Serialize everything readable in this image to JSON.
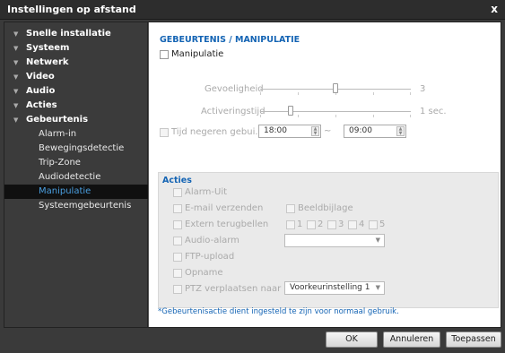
{
  "window": {
    "title": "Instellingen op afstand",
    "close": "x"
  },
  "sidebar": {
    "items": [
      {
        "label": "Snelle installatie",
        "level": "top"
      },
      {
        "label": "Systeem",
        "level": "top"
      },
      {
        "label": "Netwerk",
        "level": "top"
      },
      {
        "label": "Video",
        "level": "top"
      },
      {
        "label": "Audio",
        "level": "top"
      },
      {
        "label": "Acties",
        "level": "top"
      },
      {
        "label": "Gebeurtenis",
        "level": "top"
      },
      {
        "label": "Alarm-in",
        "level": "sub"
      },
      {
        "label": "Bewegingsdetectie",
        "level": "sub"
      },
      {
        "label": "Trip-Zone",
        "level": "sub"
      },
      {
        "label": "Audiodetectie",
        "level": "sub"
      },
      {
        "label": "Manipulatie",
        "level": "sub",
        "selected": true
      },
      {
        "label": "Systeemgebeurtenis",
        "level": "sub"
      }
    ]
  },
  "main": {
    "title": "GEBEURTENIS / MANIPULATIE",
    "manipulatie_label": "Manipulatie",
    "sensitivity": {
      "label": "Gevoeligheid",
      "value": "3",
      "level": 3,
      "max": 5
    },
    "activation": {
      "label": "Activeringstijd",
      "value": "1 sec.",
      "level": 1,
      "max": 5
    },
    "ignore": {
      "label": "Tijd negeren gebui...",
      "from": "18:00",
      "sep": "~",
      "to": "09:00"
    },
    "actions": {
      "title": "Acties",
      "alarm_out": "Alarm-Uit",
      "email": "E-mail verzenden",
      "attachment": "Beeldbijlage",
      "callback": "Extern terugbellen",
      "callback_opts": [
        "1",
        "2",
        "3",
        "4",
        "5"
      ],
      "audio": "Audio-alarm",
      "audio_select": "",
      "ftp": "FTP-upload",
      "record": "Opname",
      "ptz": "PTZ verplaatsen naar",
      "ptz_select": "Voorkeurinstelling  1"
    },
    "note": "*Gebeurtenisactie dient ingesteld te zijn voor normaal gebruik."
  },
  "buttons": {
    "ok": "OK",
    "cancel": "Annuleren",
    "apply": "Toepassen"
  }
}
